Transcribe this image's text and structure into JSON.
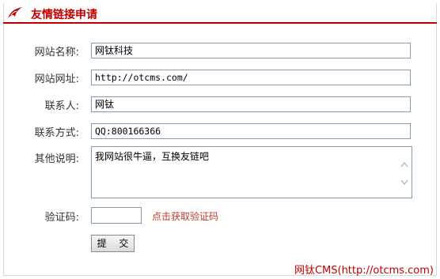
{
  "header": {
    "title": "友情链接申请"
  },
  "form": {
    "site_name": {
      "label": "网站名称:",
      "value": "网钛科技"
    },
    "site_url": {
      "label": "网站网址:",
      "value": "http://otcms.com/"
    },
    "contact": {
      "label": "联系人:",
      "value": "网钛"
    },
    "contact_method": {
      "label": "联系方式:",
      "value": "QQ:800166366"
    },
    "other_note": {
      "label": "其他说明:",
      "value": "我网站很牛逼，互换友链吧"
    },
    "captcha": {
      "label": "验证码:",
      "value": "",
      "refresh_link": "点击获取验证码"
    },
    "submit_label": "提 交"
  },
  "footer": {
    "text": "网钛CMS(http://otcms.com)"
  },
  "colors": {
    "accent": "#c00000",
    "border": "#7f9db9"
  }
}
